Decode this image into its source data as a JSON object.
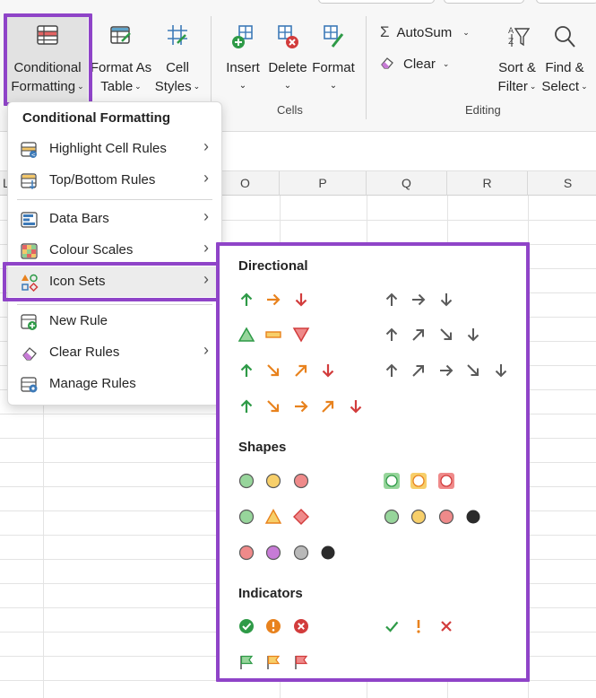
{
  "ribbon": {
    "conditional_formatting": {
      "line1": "Conditional",
      "line2": "Formatting",
      "icon": "conditional-formatting-icon"
    },
    "format_as_table": {
      "line1": "Format As",
      "line2": "Table",
      "icon": "format-as-table-icon"
    },
    "cell_styles": {
      "line1": "Cell",
      "line2": "Styles",
      "icon": "cell-styles-icon"
    },
    "insert": {
      "label": "Insert",
      "icon": "insert-cells-icon"
    },
    "delete": {
      "label": "Delete",
      "icon": "delete-cells-icon"
    },
    "format": {
      "label": "Format",
      "icon": "format-cells-icon"
    },
    "cells_group": "Cells",
    "autosum": {
      "label": "AutoSum",
      "icon": "sigma-icon"
    },
    "clear": {
      "label": "Clear",
      "icon": "eraser-icon"
    },
    "sort_filter": {
      "line1": "Sort &",
      "line2": "Filter",
      "icon": "sort-filter-icon"
    },
    "find_select": {
      "line1": "Find &",
      "line2": "Select",
      "icon": "magnifier-icon"
    },
    "editing_group": "Editing",
    "chevron": "⌄"
  },
  "sheet": {
    "columns": [
      "L",
      "O",
      "P",
      "Q",
      "R",
      "S"
    ]
  },
  "menu": {
    "title": "Conditional Formatting",
    "items": [
      {
        "label": "Highlight Cell Rules",
        "has_submenu": true,
        "icon": "highlight-cell-rules-icon"
      },
      {
        "label": "Top/Bottom Rules",
        "has_submenu": true,
        "icon": "top-bottom-rules-icon"
      },
      {
        "label": "Data Bars",
        "has_submenu": true,
        "icon": "data-bars-icon"
      },
      {
        "label": "Colour Scales",
        "has_submenu": true,
        "icon": "colour-scales-icon"
      },
      {
        "label": "Icon Sets",
        "has_submenu": true,
        "icon": "icon-sets-icon"
      },
      {
        "label": "New Rule",
        "has_submenu": false,
        "icon": "new-rule-icon"
      },
      {
        "label": "Clear Rules",
        "has_submenu": true,
        "icon": "clear-rules-icon"
      },
      {
        "label": "Manage Rules",
        "has_submenu": false,
        "icon": "manage-rules-icon"
      }
    ],
    "arrow": "›"
  },
  "submenu": {
    "sections": [
      {
        "title": "Directional"
      },
      {
        "title": "Shapes"
      },
      {
        "title": "Indicators"
      }
    ]
  },
  "colors": {
    "highlight_border": "#8f44c8",
    "green": "#2e9a47",
    "orange": "#e8821e",
    "red": "#d23c3c",
    "gray": "#5a5a5a",
    "yellow_fill": "#f7cf6a",
    "green_fill": "#97d59b",
    "red_fill": "#ef8a8a",
    "purple_fill": "#c77bd6",
    "gray_fill": "#b9b9b9",
    "black": "#2b2b2b"
  }
}
